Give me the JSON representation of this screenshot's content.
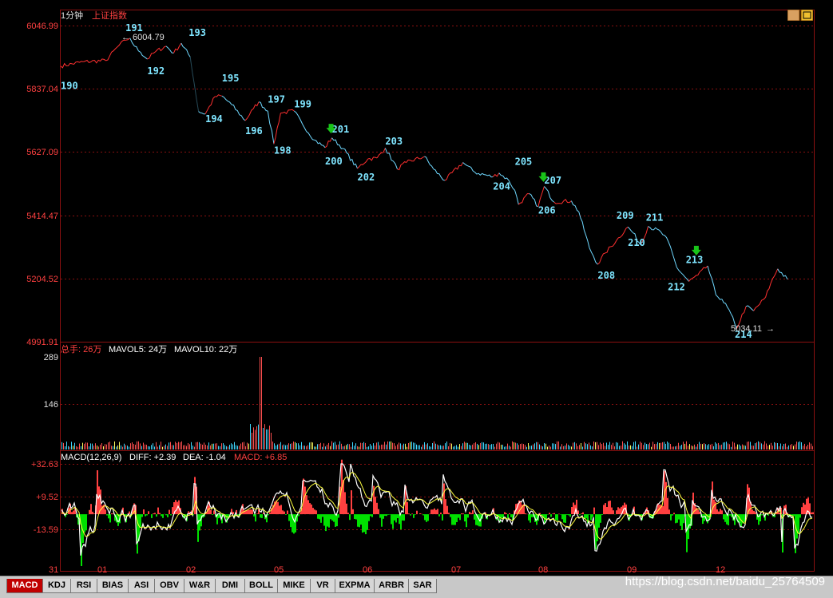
{
  "header": {
    "period": "1分钟",
    "index_name": "上证指数"
  },
  "colors": {
    "price_up": "#ff3030",
    "price_line": "#6fd8ff",
    "grid": "#8b1010",
    "axis_text": "#ff4040",
    "wave_label": "#7fe5ff",
    "macd_up": "#ff4040",
    "macd_down": "#00e000",
    "diff_line": "#ffffff",
    "dea_line": "#ffff40",
    "marker": "#19c419"
  },
  "price_panel": {
    "y_ticks": [
      "6046.99",
      "5837.04",
      "5627.09",
      "5414.47",
      "5204.52",
      "4991.91"
    ],
    "max_label": "6004.79",
    "min_label": "5034.11"
  },
  "volume_panel": {
    "header": {
      "total_label": "总手: 26万",
      "mavol5": "MAVOL5: 24万",
      "mavol10": "MAVOL10: 22万"
    },
    "y_ticks": [
      "289",
      "146"
    ]
  },
  "macd_panel": {
    "header": {
      "name": "MACD(12,26,9)",
      "diff": "DIFF: +2.39",
      "dea": "DEA: -1.04",
      "macd": "MACD: +6.85"
    },
    "y_ticks": [
      "+32.63",
      "+9.52",
      "-13.59"
    ]
  },
  "x_axis": {
    "labels": [
      "31",
      "01",
      "02",
      "05",
      "06",
      "07",
      "08",
      "09",
      "12"
    ]
  },
  "tabs": [
    "MACD",
    "KDJ",
    "RSI",
    "BIAS",
    "ASI",
    "OBV",
    "W&R",
    "DMI",
    "BOLL",
    "MIKE",
    "VR",
    "EXPMA",
    "ARBR",
    "SAR"
  ],
  "watermark": "https://blog.csdn.net/baidu_25764509",
  "chart_data": {
    "type": "line",
    "title": "上证指数",
    "ylim": [
      4991.91,
      6046.99
    ],
    "x_ticks": [
      "31",
      "01",
      "02",
      "05",
      "06",
      "07",
      "08",
      "09",
      "12"
    ],
    "price_path": [
      [
        0.0,
        5912
      ],
      [
        3.0,
        5926
      ],
      [
        6.0,
        5930
      ],
      [
        7.5,
        5975
      ],
      [
        8.6,
        5998
      ],
      [
        9.2,
        6004.79
      ],
      [
        9.8,
        5978
      ],
      [
        10.6,
        5958
      ],
      [
        11.5,
        5935
      ],
      [
        12.6,
        5960
      ],
      [
        14.0,
        5978
      ],
      [
        15.0,
        5955
      ],
      [
        16.0,
        5988
      ],
      [
        17.2,
        5942
      ],
      [
        18.3,
        5760
      ],
      [
        19.2,
        5752
      ],
      [
        20.5,
        5810
      ],
      [
        21.4,
        5812
      ],
      [
        22.7,
        5783
      ],
      [
        24.5,
        5730
      ],
      [
        25.6,
        5770
      ],
      [
        26.3,
        5792
      ],
      [
        27.5,
        5762
      ],
      [
        28.3,
        5652
      ],
      [
        29.2,
        5755
      ],
      [
        31.0,
        5762
      ],
      [
        32.1,
        5718
      ],
      [
        33.7,
        5665
      ],
      [
        35.1,
        5640
      ],
      [
        36.0,
        5672
      ],
      [
        37.5,
        5637
      ],
      [
        39.4,
        5570
      ],
      [
        40.8,
        5602
      ],
      [
        42.0,
        5605
      ],
      [
        43.1,
        5638
      ],
      [
        44.7,
        5568
      ],
      [
        45.9,
        5590
      ],
      [
        48.3,
        5610
      ],
      [
        49.5,
        5568
      ],
      [
        51.0,
        5530
      ],
      [
        53.4,
        5590
      ],
      [
        55.0,
        5557
      ],
      [
        57.4,
        5542
      ],
      [
        58.2,
        5555
      ],
      [
        59.5,
        5530
      ],
      [
        60.3,
        5497
      ],
      [
        60.8,
        5450
      ],
      [
        62.2,
        5486
      ],
      [
        63.4,
        5443
      ],
      [
        64.2,
        5510
      ],
      [
        65.5,
        5458
      ],
      [
        67.8,
        5462
      ],
      [
        68.8,
        5425
      ],
      [
        70.2,
        5305
      ],
      [
        71.3,
        5250
      ],
      [
        72.3,
        5288
      ],
      [
        73.8,
        5330
      ],
      [
        75.3,
        5375
      ],
      [
        76.0,
        5355
      ],
      [
        77.0,
        5315
      ],
      [
        78.0,
        5377
      ],
      [
        79.7,
        5358
      ],
      [
        80.7,
        5325
      ],
      [
        81.8,
        5240
      ],
      [
        83.4,
        5193
      ],
      [
        84.6,
        5214
      ],
      [
        85.9,
        5245
      ],
      [
        87.0,
        5148
      ],
      [
        87.8,
        5134
      ],
      [
        89.0,
        5085
      ],
      [
        89.7,
        5034.11
      ],
      [
        91.0,
        5110
      ],
      [
        92.0,
        5095
      ],
      [
        93.6,
        5140
      ],
      [
        94.3,
        5188
      ],
      [
        95.2,
        5235
      ],
      [
        96.5,
        5200
      ]
    ],
    "wave_labels": [
      {
        "label": "190",
        "x": 0.0,
        "y": 5835
      },
      {
        "label": "191",
        "x": 8.6,
        "y": 6028
      },
      {
        "label": "192",
        "x": 11.5,
        "y": 5885
      },
      {
        "label": "193",
        "x": 17.0,
        "y": 6012
      },
      {
        "label": "194",
        "x": 19.2,
        "y": 5725
      },
      {
        "label": "195",
        "x": 21.4,
        "y": 5860
      },
      {
        "label": "196",
        "x": 24.5,
        "y": 5685
      },
      {
        "label": "197",
        "x": 27.5,
        "y": 5790
      },
      {
        "label": "198",
        "x": 28.3,
        "y": 5620
      },
      {
        "label": "199",
        "x": 31.0,
        "y": 5774
      },
      {
        "label": "200",
        "x": 35.1,
        "y": 5583
      },
      {
        "label": "201",
        "x": 36.0,
        "y": 5690
      },
      {
        "label": "202",
        "x": 39.4,
        "y": 5530
      },
      {
        "label": "203",
        "x": 43.1,
        "y": 5650
      },
      {
        "label": "204",
        "x": 57.4,
        "y": 5500
      },
      {
        "label": "205",
        "x": 60.3,
        "y": 5582
      },
      {
        "label": "206",
        "x": 63.4,
        "y": 5420
      },
      {
        "label": "207",
        "x": 64.2,
        "y": 5520
      },
      {
        "label": "208",
        "x": 71.3,
        "y": 5202
      },
      {
        "label": "209",
        "x": 73.8,
        "y": 5402
      },
      {
        "label": "210",
        "x": 75.3,
        "y": 5312
      },
      {
        "label": "211",
        "x": 77.7,
        "y": 5396
      },
      {
        "label": "212",
        "x": 80.6,
        "y": 5164
      },
      {
        "label": "213",
        "x": 83.0,
        "y": 5254
      },
      {
        "label": "214",
        "x": 89.5,
        "y": 5005
      }
    ],
    "markers": [
      {
        "x": 35.9,
        "y": 5687
      },
      {
        "x": 64.1,
        "y": 5525
      },
      {
        "x": 84.4,
        "y": 5280
      }
    ],
    "volume_ylim": [
      0,
      289
    ],
    "volume_peak": {
      "x": 26.5,
      "value": 289
    },
    "macd_ylim": [
      -36.7,
      32.63
    ],
    "macd_ticks": [
      32.63,
      9.52,
      -13.59
    ]
  }
}
